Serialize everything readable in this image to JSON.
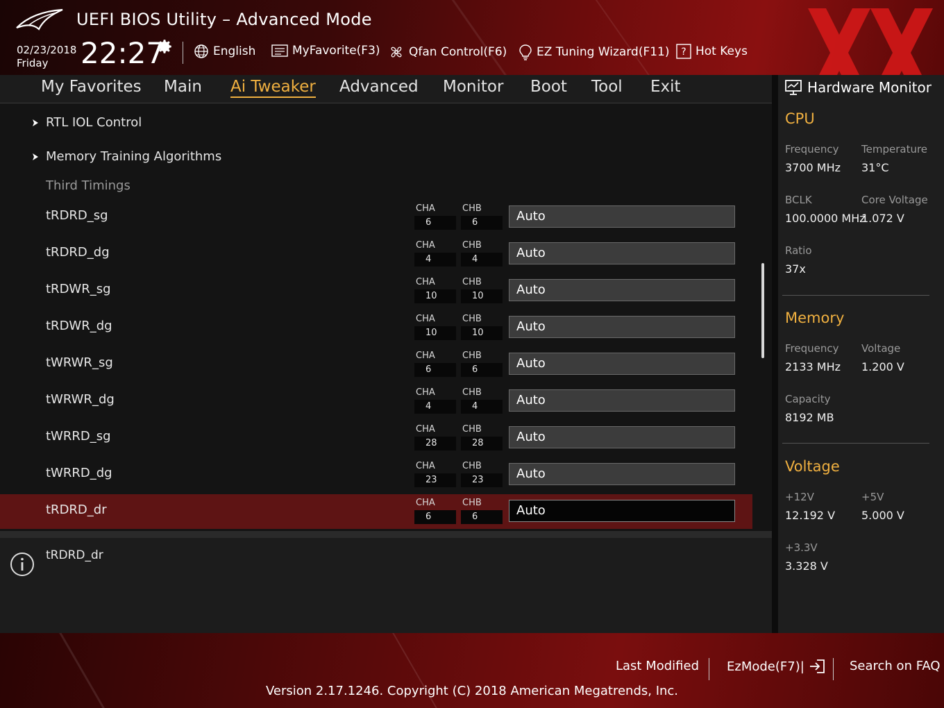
{
  "header": {
    "title": "UEFI BIOS Utility – Advanced Mode",
    "date": "02/23/2018",
    "day": "Friday",
    "time": "22:27",
    "items": [
      {
        "label": "English",
        "icon": "globe-icon"
      },
      {
        "label": "MyFavorite(F3)",
        "icon": "favorite-list-icon"
      },
      {
        "label": "Qfan Control(F6)",
        "icon": "fan-icon"
      },
      {
        "label": "EZ Tuning Wizard(F11)",
        "icon": "lightbulb-icon"
      },
      {
        "label": "Hot Keys",
        "icon": "question-box-icon"
      }
    ]
  },
  "tabs": [
    {
      "label": "My Favorites",
      "active": false
    },
    {
      "label": "Main",
      "active": false
    },
    {
      "label": "Ai Tweaker",
      "active": true
    },
    {
      "label": "Advanced",
      "active": false
    },
    {
      "label": "Monitor",
      "active": false
    },
    {
      "label": "Boot",
      "active": false
    },
    {
      "label": "Tool",
      "active": false
    },
    {
      "label": "Exit",
      "active": false
    }
  ],
  "main": {
    "submenus": [
      "RTL IOL Control",
      "Memory Training Algorithms"
    ],
    "section": "Third Timings",
    "channel_a": "CHA",
    "channel_b": "CHB",
    "rows": [
      {
        "label": "tRDRD_sg",
        "cha": "6",
        "chb": "6",
        "value": "Auto"
      },
      {
        "label": "tRDRD_dg",
        "cha": "4",
        "chb": "4",
        "value": "Auto"
      },
      {
        "label": "tRDWR_sg",
        "cha": "10",
        "chb": "10",
        "value": "Auto"
      },
      {
        "label": "tRDWR_dg",
        "cha": "10",
        "chb": "10",
        "value": "Auto"
      },
      {
        "label": "tWRWR_sg",
        "cha": "6",
        "chb": "6",
        "value": "Auto"
      },
      {
        "label": "tWRWR_dg",
        "cha": "4",
        "chb": "4",
        "value": "Auto"
      },
      {
        "label": "tWRRD_sg",
        "cha": "28",
        "chb": "28",
        "value": "Auto"
      },
      {
        "label": "tWRRD_dg",
        "cha": "23",
        "chb": "23",
        "value": "Auto"
      },
      {
        "label": "tRDRD_dr",
        "cha": "6",
        "chb": "6",
        "value": "Auto"
      }
    ],
    "selected_row": 8
  },
  "help": {
    "text": "tRDRD_dr",
    "icon": "info-icon"
  },
  "hw_monitor": {
    "title": "Hardware Monitor",
    "cpu": {
      "heading": "CPU",
      "frequency_label": "Frequency",
      "frequency": "3700 MHz",
      "temperature_label": "Temperature",
      "temperature": "31°C",
      "bclk_label": "BCLK",
      "bclk": "100.0000 MHz",
      "core_voltage_label": "Core Voltage",
      "core_voltage": "1.072 V",
      "ratio_label": "Ratio",
      "ratio": "37x"
    },
    "memory": {
      "heading": "Memory",
      "frequency_label": "Frequency",
      "frequency": "2133 MHz",
      "voltage_label": "Voltage",
      "voltage": "1.200 V",
      "capacity_label": "Capacity",
      "capacity": "8192 MB"
    },
    "voltage": {
      "heading": "Voltage",
      "v12_label": "+12V",
      "v12": "12.192 V",
      "v5_label": "+5V",
      "v5": "5.000 V",
      "v33_label": "+3.3V",
      "v33": "3.328 V"
    }
  },
  "footer": {
    "last_modified": "Last Modified",
    "ezmode": "EzMode(F7)|",
    "faq": "Search on FAQ",
    "version": "Version 2.17.1246. Copyright (C) 2018 American Megatrends, Inc."
  },
  "colors": {
    "accent": "#f0b040",
    "selected_row": "#5e1414",
    "header_red": "#8a1010"
  }
}
